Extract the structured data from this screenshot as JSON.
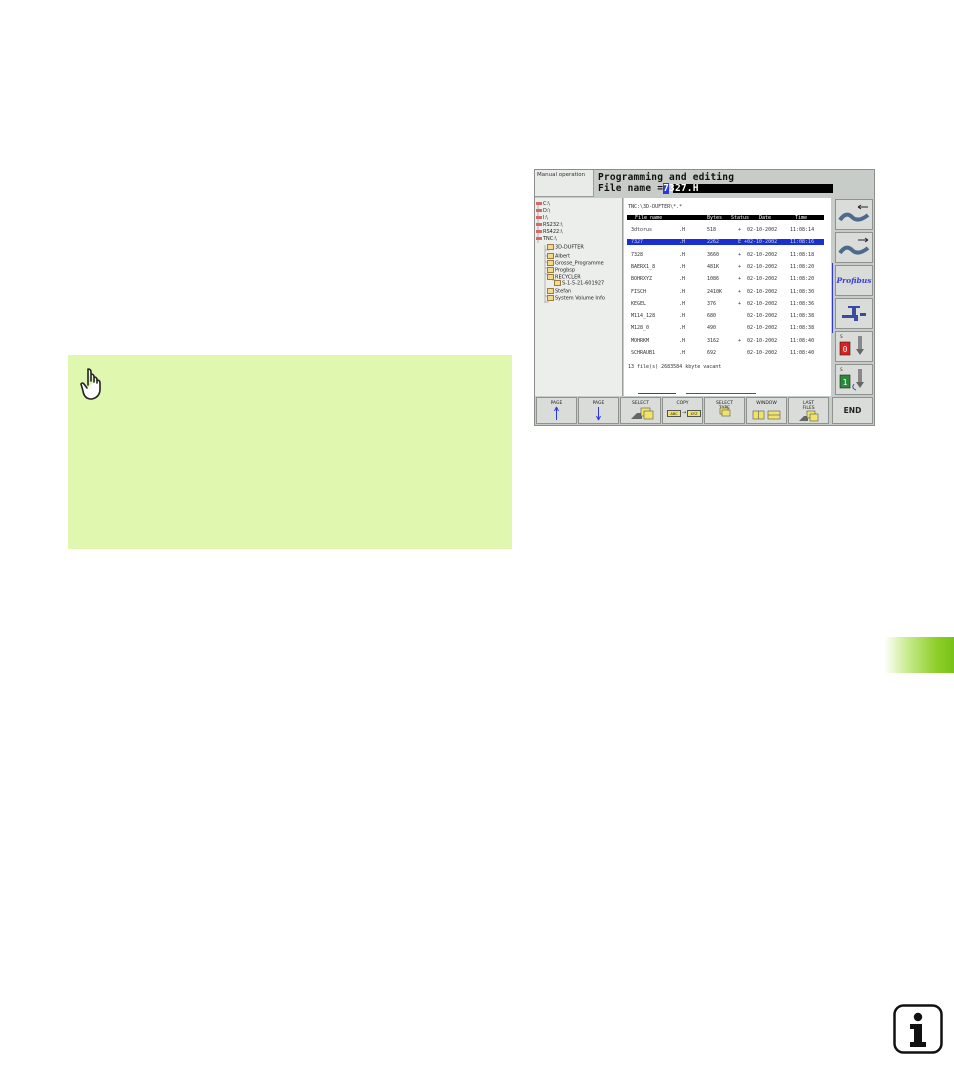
{
  "screen": {
    "mode_label": "Manual operation",
    "title": "Programming and editing",
    "file_name_label": "File name =",
    "file_name_cursor": "7",
    "file_name_rest": "327.H"
  },
  "tree": {
    "drives": [
      "C:\\",
      "D:\\",
      "I:\\",
      "RS232:\\",
      "RS422:\\",
      "TNC:\\"
    ],
    "folders": [
      "3D-DUFTER",
      "Albert",
      "Grosse_Programme",
      "Progbsp",
      "RECYCLER",
      "S-1-5-21-601927",
      "Stefan",
      "System Volume Info"
    ]
  },
  "file_list": {
    "path": "TNC:\\3D-DUFTER\\*.*",
    "headers": {
      "name": "File name",
      "bytes": "Bytes",
      "status": "Status",
      "date": "Date",
      "time": "Time"
    },
    "rows": [
      {
        "name": "3dtorus",
        "ext": ".H",
        "bytes": "518",
        "status": "+",
        "date": "02-10-2002",
        "time": "11:08:14"
      },
      {
        "name": "7327",
        "ext": ".H",
        "bytes": "2262",
        "status": "E +",
        "date": "02-10-2002",
        "time": "11:08:16"
      },
      {
        "name": "7328",
        "ext": ".H",
        "bytes": "3660",
        "status": "+",
        "date": "02-10-2002",
        "time": "11:08:18"
      },
      {
        "name": "BAERX1_8",
        "ext": ".H",
        "bytes": "481K",
        "status": "+",
        "date": "02-10-2002",
        "time": "11:08:20"
      },
      {
        "name": "BOHRXYZ",
        "ext": ".H",
        "bytes": "1086",
        "status": "+",
        "date": "02-10-2002",
        "time": "11:08:20"
      },
      {
        "name": "FISCH",
        "ext": ".H",
        "bytes": "2410K",
        "status": "+",
        "date": "02-10-2002",
        "time": "11:08:30"
      },
      {
        "name": "KEGEL",
        "ext": ".H",
        "bytes": "376",
        "status": "+",
        "date": "02-10-2002",
        "time": "11:08:36"
      },
      {
        "name": "M114_128",
        "ext": ".H",
        "bytes": "680",
        "status": "",
        "date": "02-10-2002",
        "time": "11:08:38"
      },
      {
        "name": "M128_0",
        "ext": ".H",
        "bytes": "490",
        "status": "",
        "date": "02-10-2002",
        "time": "11:08:38"
      },
      {
        "name": "MOHRKM",
        "ext": ".H",
        "bytes": "3162",
        "status": "+",
        "date": "02-10-2002",
        "time": "11:08:40"
      },
      {
        "name": "SCHRAUB1",
        "ext": ".H",
        "bytes": "692",
        "status": "",
        "date": "02-10-2002",
        "time": "11:08:40"
      }
    ],
    "footer": "13  file(s) 2683584 kbyte vacant",
    "selected_index": 1
  },
  "right_softkeys": {
    "profibus": "Profibus",
    "off_label": "0",
    "on_label": "1",
    "small_s": "S"
  },
  "bottom_softkeys": [
    {
      "label": "PAGE"
    },
    {
      "label": "PAGE"
    },
    {
      "label": "SELECT"
    },
    {
      "label": "COPY",
      "sub_left": "ABC",
      "sub_right": "XYZ"
    },
    {
      "label": "SELECT TYPE"
    },
    {
      "label": "WINDOW"
    },
    {
      "label": "LAST FILES"
    },
    {
      "label": "END"
    }
  ],
  "colors": {
    "note_bg": "#e0f7b0",
    "tab_green": "#78c21a",
    "selection_blue": "#1a2fd0"
  }
}
